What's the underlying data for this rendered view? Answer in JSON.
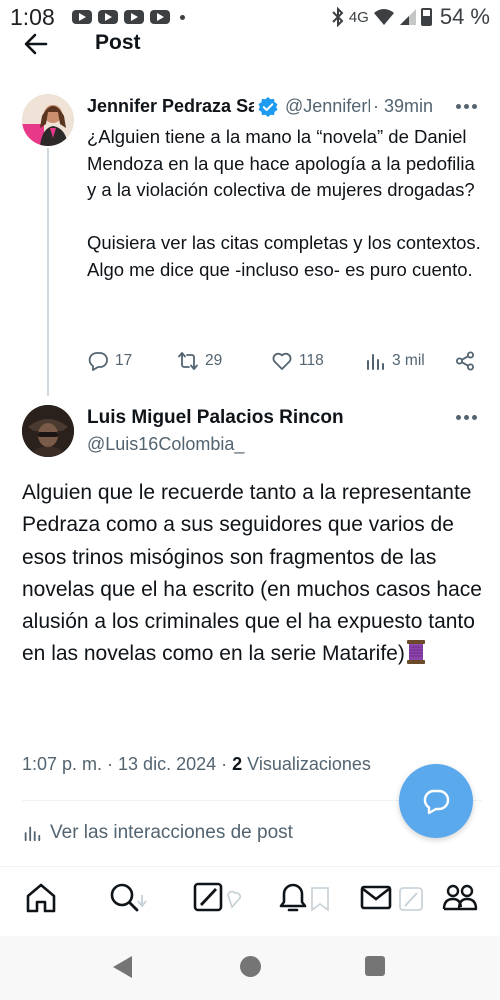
{
  "status_bar": {
    "time": "1:08",
    "network": "4G",
    "battery": "54 %",
    "notification_icons": [
      "youtube-icon",
      "youtube-icon",
      "youtube-icon",
      "youtube-icon"
    ]
  },
  "header": {
    "back_icon": "arrow-left-icon",
    "title": "Post"
  },
  "original_post": {
    "author_name": "Jennifer Pedraza Sandoval",
    "verified": true,
    "handle": "@JenniferPedraza",
    "time_ago": "39min",
    "text": "¿Alguien tiene a la mano la “novela” de Daniel Mendoza en la que hace apología a la pedofilia y a la violación colectiva de mujeres drogadas?\n\nQuisiera ver las citas completas y los contextos. Algo me dice que -incluso eso- es puro cuento.",
    "stats": {
      "replies": "17",
      "reposts": "29",
      "likes": "118",
      "views": "3 mil"
    }
  },
  "reply_post": {
    "author_name": "Luis Miguel Palacios Rincon",
    "handle": "@Luis16Colombia_",
    "text": "Alguien que le recuerde tanto a la representante Pedraza como a sus seguidores que varios de esos trinos misóginos son fragmentos de las novelas que el ha escrito (en muchos casos hace alusión a los criminales que el ha expuesto tanto en las novelas como en la serie Matarife)",
    "emoji_icon": "thread-spool-icon",
    "timestamp": "1:07 p. m. · 13 dic. 2024 ·",
    "views_count": "2",
    "views_label": "Visualizaciones",
    "interactions_link": "Ver las interacciones de post"
  },
  "fab_icon": "reply-bubble-icon",
  "tab_bar": [
    "home-icon",
    "search-icon",
    "grok-icon",
    "notifications-icon",
    "messages-icon",
    "communities-icon"
  ],
  "colors": {
    "accent": "#1d9bf0",
    "fab": "#5aa9ec",
    "secondary_text": "#536471",
    "primary_text": "#0f1419"
  }
}
